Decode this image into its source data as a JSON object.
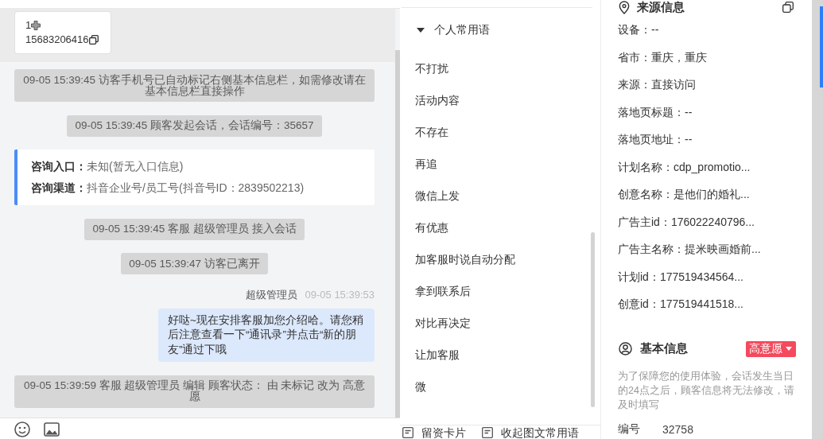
{
  "visitor_card": {
    "name": "1",
    "phone": "15683206416"
  },
  "chat": [
    {
      "kind": "system",
      "text": "09-05 15:39:45 访客手机号已自动标记右侧基本信息栏，如需修改请在基本信息栏直接操作"
    },
    {
      "kind": "system",
      "text": "09-05 15:39:45 顾客发起会话，会话编号：35657"
    },
    {
      "kind": "entry_card",
      "rows": [
        {
          "label": "咨询入口：",
          "value": "未知(暂无入口信息)"
        },
        {
          "label": "咨询渠道：",
          "value": "抖音企业号/员工号(抖音号ID：2839502213)"
        }
      ]
    },
    {
      "kind": "system",
      "text": "09-05 15:39:45 客服 超级管理员 接入会话"
    },
    {
      "kind": "system",
      "text": "09-05 15:39:47 访客已离开"
    },
    {
      "kind": "agent",
      "sender": "超级管理员",
      "time": "09-05 15:39:53",
      "text": "好哒~现在安排客服加您介绍哈。请您稍后注意查看一下“通讯录”并点击“新的朋友”通过下哦"
    },
    {
      "kind": "system",
      "text": "09-05 15:39:59 客服 超级管理员 编辑 顾客状态： 由 未标记 改为 高意愿"
    }
  ],
  "phrases": {
    "title": "个人常用语",
    "expanded": true,
    "items": [
      "不打扰",
      "活动内容",
      "不存在",
      "再追",
      "微信上发",
      "有优惠",
      "加客服时说自动分配",
      "拿到联系后",
      "对比再决定",
      "让加客服",
      "微"
    ]
  },
  "phrase_footer": [
    "留资卡片",
    "收起图文常用语"
  ],
  "source_info": {
    "title": "来源信息",
    "lines": [
      "设备：--",
      "省市：重庆，重庆",
      "来源：直接访问",
      "落地页标题：--",
      "落地页地址：--",
      "计划名称：cdp_promotio...",
      "创意名称：是他们的婚礼...",
      "广告主id：176022240796...",
      "广告主名称：提米映画婚前...",
      "计划id：177519434564...",
      "创意id：177519441518..."
    ]
  },
  "basic_info": {
    "title": "基本信息",
    "status_tag": "高意愿",
    "notice": "为了保障您的使用体验，会话发生当日的24点之后，顾客信息将无法修改，请及时填写",
    "fields": [
      {
        "label": "编号",
        "value": "32758"
      }
    ]
  }
}
